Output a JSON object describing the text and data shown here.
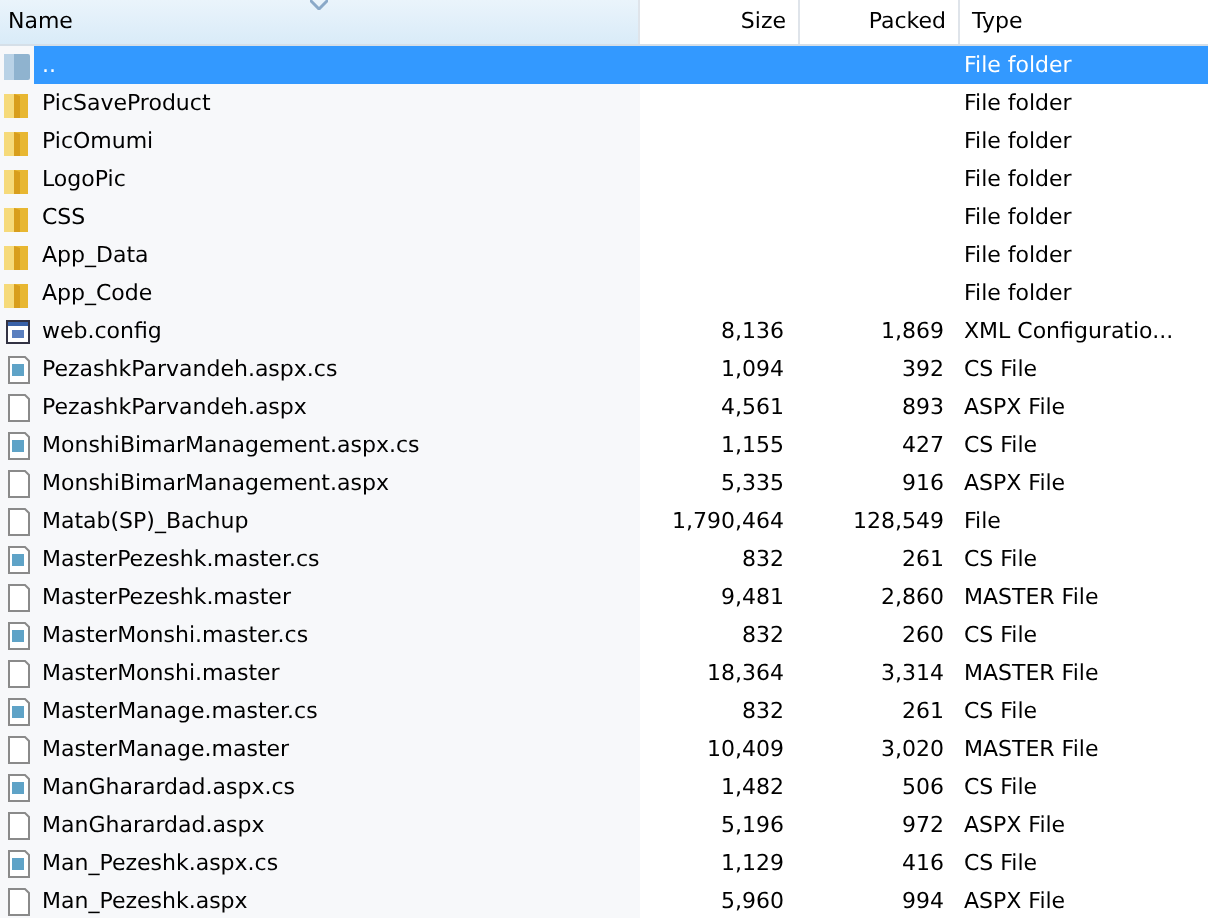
{
  "table": {
    "columns": [
      {
        "label": "Name",
        "sorted": true
      },
      {
        "label": "Size",
        "sorted": false
      },
      {
        "label": "Packed",
        "sorted": false
      },
      {
        "label": "Type",
        "sorted": false
      }
    ],
    "rows": [
      {
        "kind": "parent",
        "name": "..",
        "type": "File folder",
        "selected": true
      },
      {
        "kind": "folder",
        "name": "PicSaveProduct",
        "type": "File folder",
        "selected": false
      },
      {
        "kind": "folder",
        "name": "PicOmumi",
        "type": "File folder",
        "selected": false
      },
      {
        "kind": "folder",
        "name": "LogoPic",
        "type": "File folder",
        "selected": false
      },
      {
        "kind": "folder",
        "name": "CSS",
        "type": "File folder",
        "selected": false
      },
      {
        "kind": "folder",
        "name": "App_Data",
        "type": "File folder",
        "selected": false
      },
      {
        "kind": "folder",
        "name": "App_Code",
        "type": "File folder",
        "selected": false
      },
      {
        "kind": "config",
        "name": "web.config",
        "size": "8,136",
        "packed": "1,869",
        "type": "XML Configuratio...",
        "selected": false
      },
      {
        "kind": "code",
        "name": "PezashkParvandeh.aspx.cs",
        "size": "1,094",
        "packed": "392",
        "type": "CS File",
        "selected": false
      },
      {
        "kind": "file",
        "name": "PezashkParvandeh.aspx",
        "size": "4,561",
        "packed": "893",
        "type": "ASPX File",
        "selected": false
      },
      {
        "kind": "code",
        "name": "MonshiBimarManagement.aspx.cs",
        "size": "1,155",
        "packed": "427",
        "type": "CS File",
        "selected": false
      },
      {
        "kind": "file",
        "name": "MonshiBimarManagement.aspx",
        "size": "5,335",
        "packed": "916",
        "type": "ASPX File",
        "selected": false
      },
      {
        "kind": "file",
        "name": "Matab(SP)_Bachup",
        "size": "1,790,464",
        "packed": "128,549",
        "type": "File",
        "selected": false
      },
      {
        "kind": "code",
        "name": "MasterPezeshk.master.cs",
        "size": "832",
        "packed": "261",
        "type": "CS File",
        "selected": false
      },
      {
        "kind": "file",
        "name": "MasterPezeshk.master",
        "size": "9,481",
        "packed": "2,860",
        "type": "MASTER File",
        "selected": false
      },
      {
        "kind": "code",
        "name": "MasterMonshi.master.cs",
        "size": "832",
        "packed": "260",
        "type": "CS File",
        "selected": false
      },
      {
        "kind": "file",
        "name": "MasterMonshi.master",
        "size": "18,364",
        "packed": "3,314",
        "type": "MASTER File",
        "selected": false
      },
      {
        "kind": "code",
        "name": "MasterManage.master.cs",
        "size": "832",
        "packed": "261",
        "type": "CS File",
        "selected": false
      },
      {
        "kind": "file",
        "name": "MasterManage.master",
        "size": "10,409",
        "packed": "3,020",
        "type": "MASTER File",
        "selected": false
      },
      {
        "kind": "code",
        "name": "ManGharardad.aspx.cs",
        "size": "1,482",
        "packed": "506",
        "type": "CS File",
        "selected": false
      },
      {
        "kind": "file",
        "name": "ManGharardad.aspx",
        "size": "5,196",
        "packed": "972",
        "type": "ASPX File",
        "selected": false
      },
      {
        "kind": "code",
        "name": "Man_Pezeshk.aspx.cs",
        "size": "1,129",
        "packed": "416",
        "type": "CS File",
        "selected": false
      },
      {
        "kind": "file",
        "name": "Man_Pezeshk.aspx",
        "size": "5,960",
        "packed": "994",
        "type": "ASPX File",
        "selected": false
      }
    ]
  }
}
